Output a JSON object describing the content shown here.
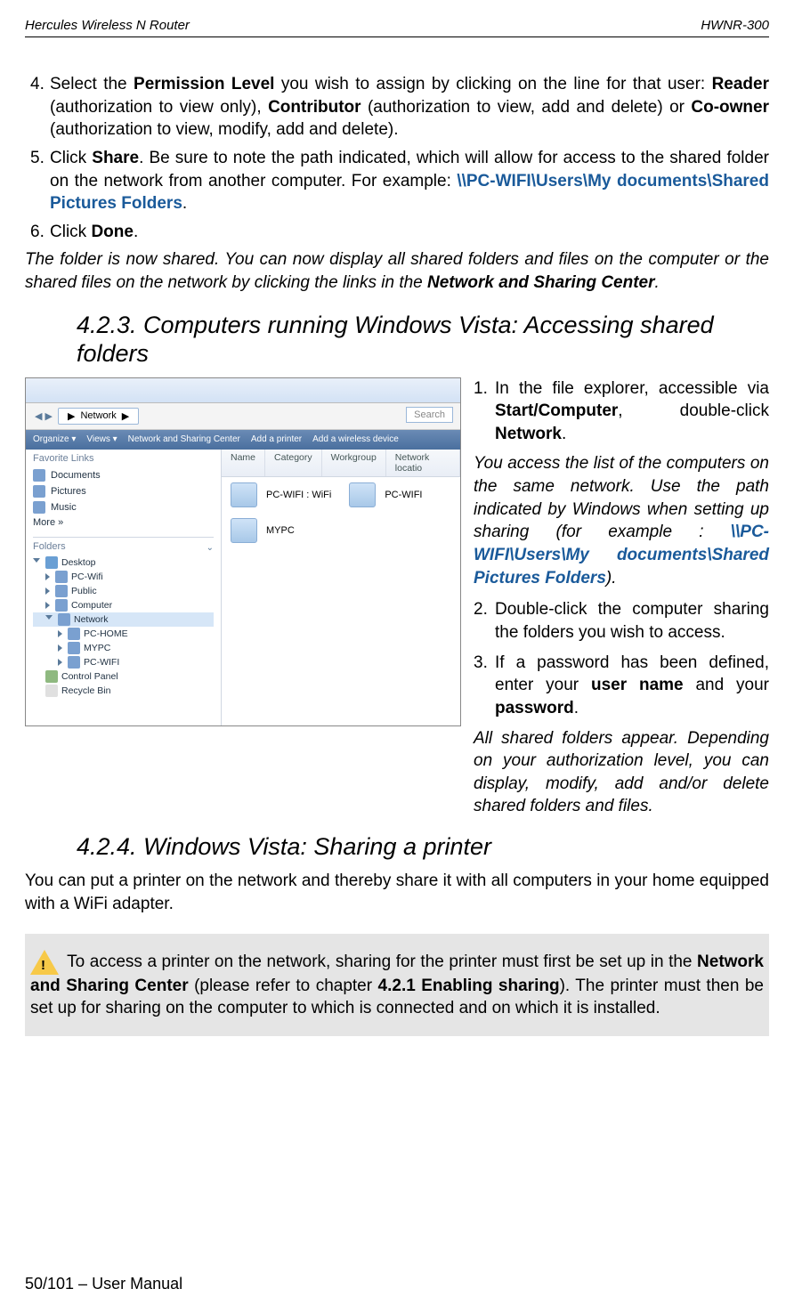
{
  "header": {
    "left": "Hercules Wireless N Router",
    "right": "HWNR-300"
  },
  "footer": "50/101 – User Manual",
  "list1": [
    {
      "num": "4.",
      "pre": "Select the ",
      "b1": "Permission Level",
      "mid1": " you wish to assign by clicking on the line for that user: ",
      "b2": "Reader",
      "mid2": " (authorization to view only), ",
      "b3": "Contributor",
      "mid3": " (authorization to view, add and delete) or ",
      "b4": "Co-owner",
      "mid4": " (authorization to view, modify, add and delete)."
    },
    {
      "num": "5.",
      "pre": "Click ",
      "b1": "Share",
      "mid1": ".  Be sure to note the path indicated, which will allow for access to the shared folder on the network from another computer. For example: ",
      "blue": "\\\\PC-WIFI\\Users\\My documents\\Shared Pictures Folders",
      "post": "."
    },
    {
      "num": "6.",
      "pre": "Click ",
      "b1": "Done",
      "post": "."
    }
  ],
  "note1": {
    "pre": "The folder is now shared.  You can now display all shared folders and files on the computer or the shared files on the network by clicking the links in the ",
    "b": "Network and Sharing Center",
    "post": "."
  },
  "heading1": "4.2.3.  Computers running Windows Vista: Accessing shared folders",
  "heading2": "4.2.4. Windows Vista: Sharing a printer",
  "screenshot": {
    "breadcrumb_arrow": "▶",
    "breadcrumb": "Network",
    "search": "Search",
    "toolbar": [
      "Organize ▾",
      "Views ▾",
      "Network and Sharing Center",
      "Add a printer",
      "Add a wireless device"
    ],
    "fav_label": "Favorite Links",
    "fav_items": [
      "Documents",
      "Pictures",
      "Music",
      "More »"
    ],
    "folders_label": "Folders",
    "tree": [
      "Desktop",
      "PC-Wifi",
      "Public",
      "Computer",
      "Network",
      "PC-HOME",
      "MYPC",
      "PC-WIFI",
      "Control Panel",
      "Recycle Bin"
    ],
    "columns": [
      "Name",
      "Category",
      "Workgroup",
      "Network locatio"
    ],
    "items": [
      "PC-WIFI : WiFi",
      "PC-WIFI",
      "MYPC"
    ]
  },
  "right": {
    "item1": {
      "num": "1.",
      "pre": "In the file explorer, accessible via ",
      "b1": "Start/Computer",
      "mid": ", double-click ",
      "b2": "Network",
      "post": "."
    },
    "para1": {
      "pre": "You access the list of the computers on the same network.  Use the path indicated by Windows when setting up sharing (for example : ",
      "blue": "\\\\PC-WIFI\\Users\\My documents\\Shared Pictures Folders",
      "post": ")."
    },
    "item2": {
      "num": "2.",
      "text": "Double-click the computer sharing the folders you wish to access."
    },
    "item3": {
      "num": "3.",
      "pre": "If a password has been defined, enter your ",
      "b1": "user name",
      "mid": " and your ",
      "b2": "password",
      "post": "."
    },
    "para2": "All shared folders appear. Depending on your authorization level, you can display, modify, add and/or delete shared folders and files."
  },
  "printer_para": "You can put a printer on the network and thereby share it with all computers in your home equipped with a WiFi adapter.",
  "gray": {
    "pre": " To access a printer on the network, sharing for the printer must first be set up in the ",
    "b1": "Network and Sharing Center",
    "mid1": " (please refer to chapter ",
    "b2": "4.2.1 Enabling sharing",
    "post": ").  The printer must then be set up for sharing on the computer to which is connected and on which it is installed."
  }
}
